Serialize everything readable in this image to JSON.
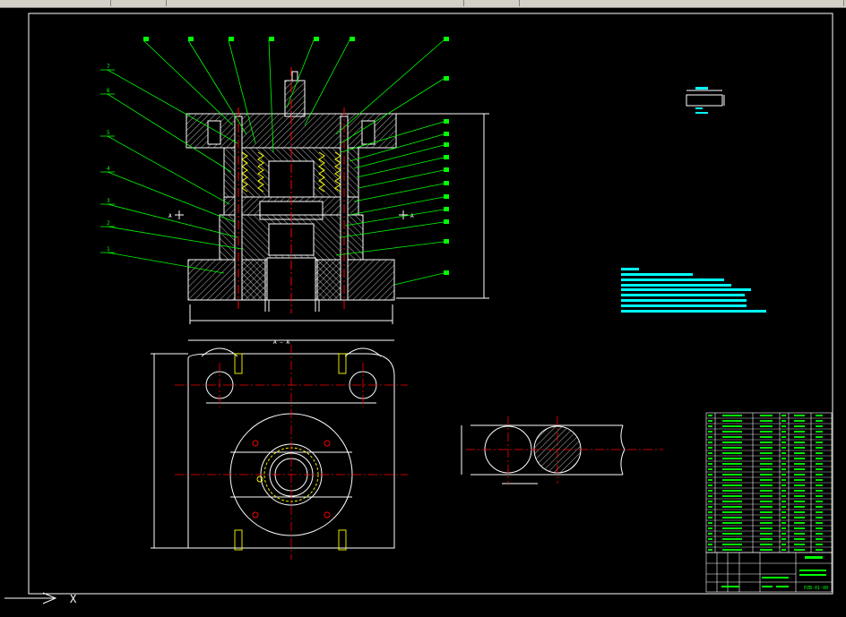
{
  "toolbar": {
    "segments": [
      "",
      "",
      "",
      "",
      ""
    ]
  },
  "drawing": {
    "section_label": "A — A",
    "cut_mark": "A",
    "plan_label": "A — A",
    "drawing_number": "PZB-01-00",
    "colors": {
      "background": "#000000",
      "frame": "#ffffff",
      "outline": "#ffffff",
      "leader": "#00ff00",
      "centerline": "#ff0000",
      "hidden": "#ffff00",
      "notes": "#00ffff",
      "hatch": "#ffffff"
    },
    "section_balloons_left": [
      "7",
      "6",
      "5",
      "4",
      "3",
      "2",
      "1"
    ],
    "section_balloons_top": [
      "8",
      "9",
      "10",
      "11",
      "12",
      "13"
    ],
    "section_balloons_right": [
      "14",
      "15",
      "16",
      "17",
      "18",
      "19",
      "20",
      "21",
      "22",
      "23",
      "24"
    ],
    "bom_rows": 26,
    "title_block": {
      "drawing_no": "PZB-01-00"
    },
    "ucs_label": "X"
  }
}
